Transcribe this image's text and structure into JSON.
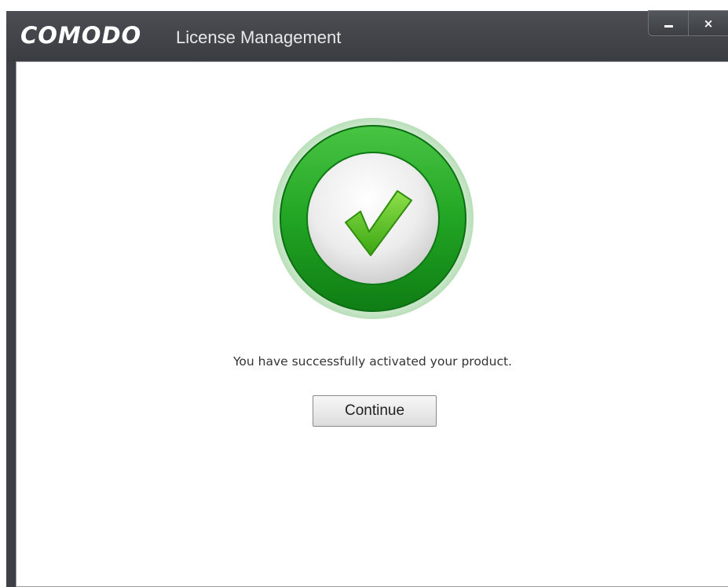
{
  "window": {
    "brand": "COMODO",
    "title": "License Management",
    "controls": {
      "minimize_icon": "minimize-icon",
      "close_label": "×"
    }
  },
  "content": {
    "status_icon": "checkmark-success-icon",
    "message": "You have successfully activated your product.",
    "continue_label": "Continue"
  },
  "colors": {
    "titlebar": "#3d4044",
    "success_green": "#2ea32e",
    "checkmark_green": "#5bc51e"
  }
}
